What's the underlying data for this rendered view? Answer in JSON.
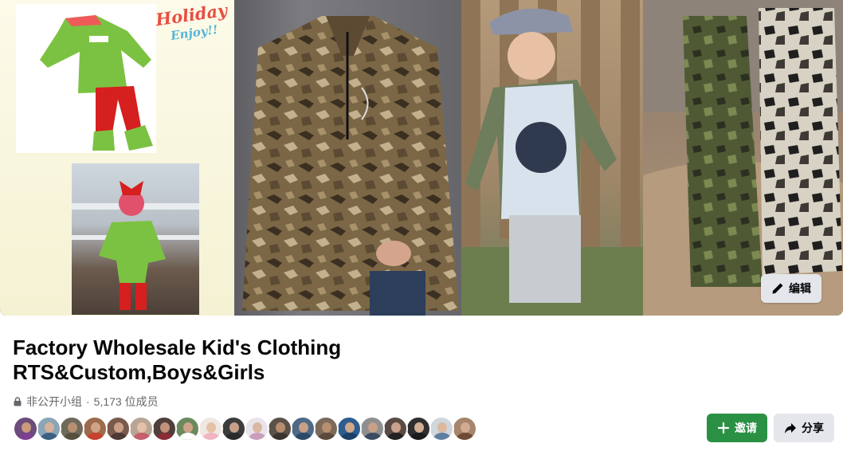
{
  "cover": {
    "overlay_text_1": "Holiday",
    "overlay_text_2": "Enjoy!!",
    "edit_label": "编辑"
  },
  "group": {
    "title_line1": "Factory Wholesale Kid's Clothing",
    "title_line2": "RTS&Custom,Boys&Girls",
    "privacy": "非公开小组",
    "separator": "·",
    "members": "5,173 位成员"
  },
  "actions": {
    "join_label": "邀请",
    "share_label": "分享"
  },
  "icons": {
    "edit": "pencil-icon",
    "privacy": "lock-icon",
    "join": "plus-icon",
    "share": "share-arrow-icon"
  },
  "colors": {
    "join_button": "#2a9144",
    "secondary_button": "#e4e6eb",
    "meta_text": "#65676b"
  },
  "avatars": [
    {
      "bg": "#6b4c7a",
      "face": "#c99a7c",
      "body": "#7d3f8f"
    },
    {
      "bg": "#8aa5b5",
      "face": "#d6b09a",
      "body": "#3c5f82"
    },
    {
      "bg": "#6f6a5a",
      "face": "#b88f70",
      "body": "#56503c"
    },
    {
      "bg": "#9c6a4c",
      "face": "#d1a385",
      "body": "#c8412e"
    },
    {
      "bg": "#7a5a4c",
      "face": "#caa087",
      "body": "#4d3a34"
    },
    {
      "bg": "#b8a595",
      "face": "#e3c0a8",
      "body": "#c65e6b"
    },
    {
      "bg": "#4e3f3c",
      "face": "#c29178",
      "body": "#8a2b36"
    },
    {
      "bg": "#6b8a5c",
      "face": "#cda48a",
      "body": "#ffffff"
    },
    {
      "bg": "#efe8e2",
      "face": "#e4c2a8",
      "body": "#f1b6c1"
    },
    {
      "bg": "#3c3c3c",
      "face": "#c8a088",
      "body": "#2b2b2b"
    },
    {
      "bg": "#e9e3ea",
      "face": "#d9b8a3",
      "body": "#c89ebb"
    },
    {
      "bg": "#5a5248",
      "face": "#b78d70",
      "body": "#39342f"
    },
    {
      "bg": "#4f6a87",
      "face": "#c9a087",
      "body": "#2c4a68"
    },
    {
      "bg": "#7c6b5a",
      "face": "#b98f72",
      "body": "#5b4a3b"
    },
    {
      "bg": "#2d5d8f",
      "face": "#d0a788",
      "body": "#1d3f64"
    },
    {
      "bg": "#8f8f8f",
      "face": "#c7a189",
      "body": "#3b4b63"
    },
    {
      "bg": "#5a4a45",
      "face": "#caa18c",
      "body": "#222222"
    },
    {
      "bg": "#2f2f2f",
      "face": "#d1ae95",
      "body": "#1b1b1b"
    },
    {
      "bg": "#cfd6dc",
      "face": "#dbb89e",
      "body": "#5e7fa0"
    },
    {
      "bg": "#a6856c",
      "face": "#d3ab90",
      "body": "#6f4a35"
    }
  ]
}
